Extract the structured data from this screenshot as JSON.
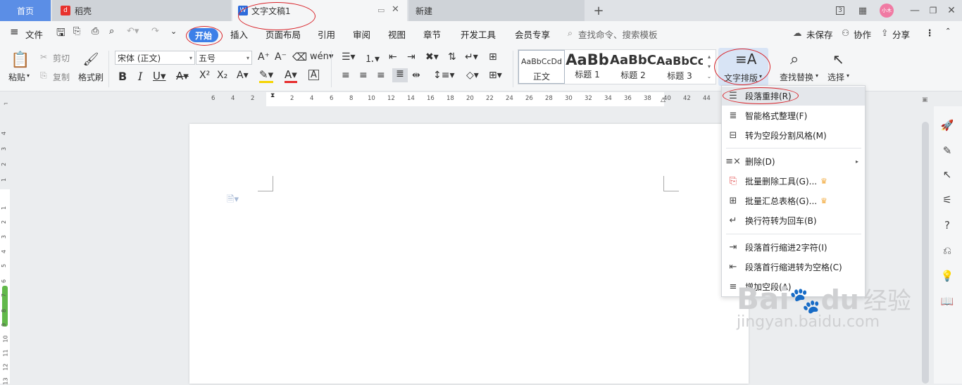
{
  "tabs": {
    "home": "首页",
    "daoke": "稻壳",
    "document": "文字文稿1",
    "new_tab": "新建"
  },
  "window_controls": {
    "layout_label": "3",
    "avatar_text": "小木"
  },
  "menu": {
    "file": "文件",
    "start": "开始",
    "insert": "插入",
    "page_layout": "页面布局",
    "reference": "引用",
    "review": "审阅",
    "view": "视图",
    "chapter": "章节",
    "dev_tools": "开发工具",
    "member": "会员专享",
    "search_placeholder": "查找命令、搜索模板",
    "unsaved": "未保存",
    "collab": "协作",
    "share": "分享"
  },
  "ribbon": {
    "paste": "粘贴",
    "cut": "剪切",
    "copy": "复制",
    "format_painter": "格式刷",
    "font_name": "宋体 (正文)",
    "font_size": "五号",
    "styles": [
      {
        "preview": "AaBbCcDd",
        "name": "正文"
      },
      {
        "preview": "AaBb",
        "name": "标题 1"
      },
      {
        "preview": "AaBbC",
        "name": "标题 2"
      },
      {
        "preview": "AaBbCc",
        "name": "标题 3"
      }
    ],
    "text_layout": "文字排版",
    "find_replace": "查找替换",
    "select": "选择"
  },
  "ruler_numbers": [
    "6",
    "4",
    "2",
    "2",
    "4",
    "6",
    "8",
    "10",
    "12",
    "14",
    "16",
    "18",
    "20",
    "22",
    "24",
    "26",
    "28",
    "30",
    "32",
    "34",
    "36",
    "38",
    "40",
    "42",
    "44"
  ],
  "left_ruler_numbers": [
    "4",
    "3",
    "2",
    "1",
    "1",
    "2",
    "3",
    "4",
    "5",
    "6",
    "7",
    "8",
    "9",
    "10",
    "11",
    "12",
    "13"
  ],
  "dropdown": {
    "items": [
      {
        "label": "段落重排(R)",
        "icon": "reflow-icon"
      },
      {
        "label": "智能格式整理(F)",
        "icon": "smart-format-icon"
      },
      {
        "label": "转为空段分割风格(M)",
        "icon": "empty-paragraph-icon"
      },
      {
        "label": "删除(D)",
        "icon": "delete-icon"
      },
      {
        "label": "批量删除工具(G)...",
        "icon": "batch-delete-icon"
      },
      {
        "label": "批量汇总表格(G)...",
        "icon": "batch-table-icon"
      },
      {
        "label": "换行符转为回车(B)",
        "icon": "linebreak-icon"
      },
      {
        "label": "段落首行缩进2字符(I)",
        "icon": "indent-icon"
      },
      {
        "label": "段落首行缩进转为空格(C)",
        "icon": "indent-space-icon"
      },
      {
        "label": "增加空段(A)",
        "icon": "add-paragraph-icon"
      }
    ]
  },
  "watermark": {
    "brand": "Bai",
    "brand2": "du",
    "product": "经验",
    "url": "jingyan.baidu.com"
  },
  "colors": {
    "accent": "#3c7fe8",
    "annotation": "#d9252b",
    "menu_highlight": "#d8e4f5"
  }
}
